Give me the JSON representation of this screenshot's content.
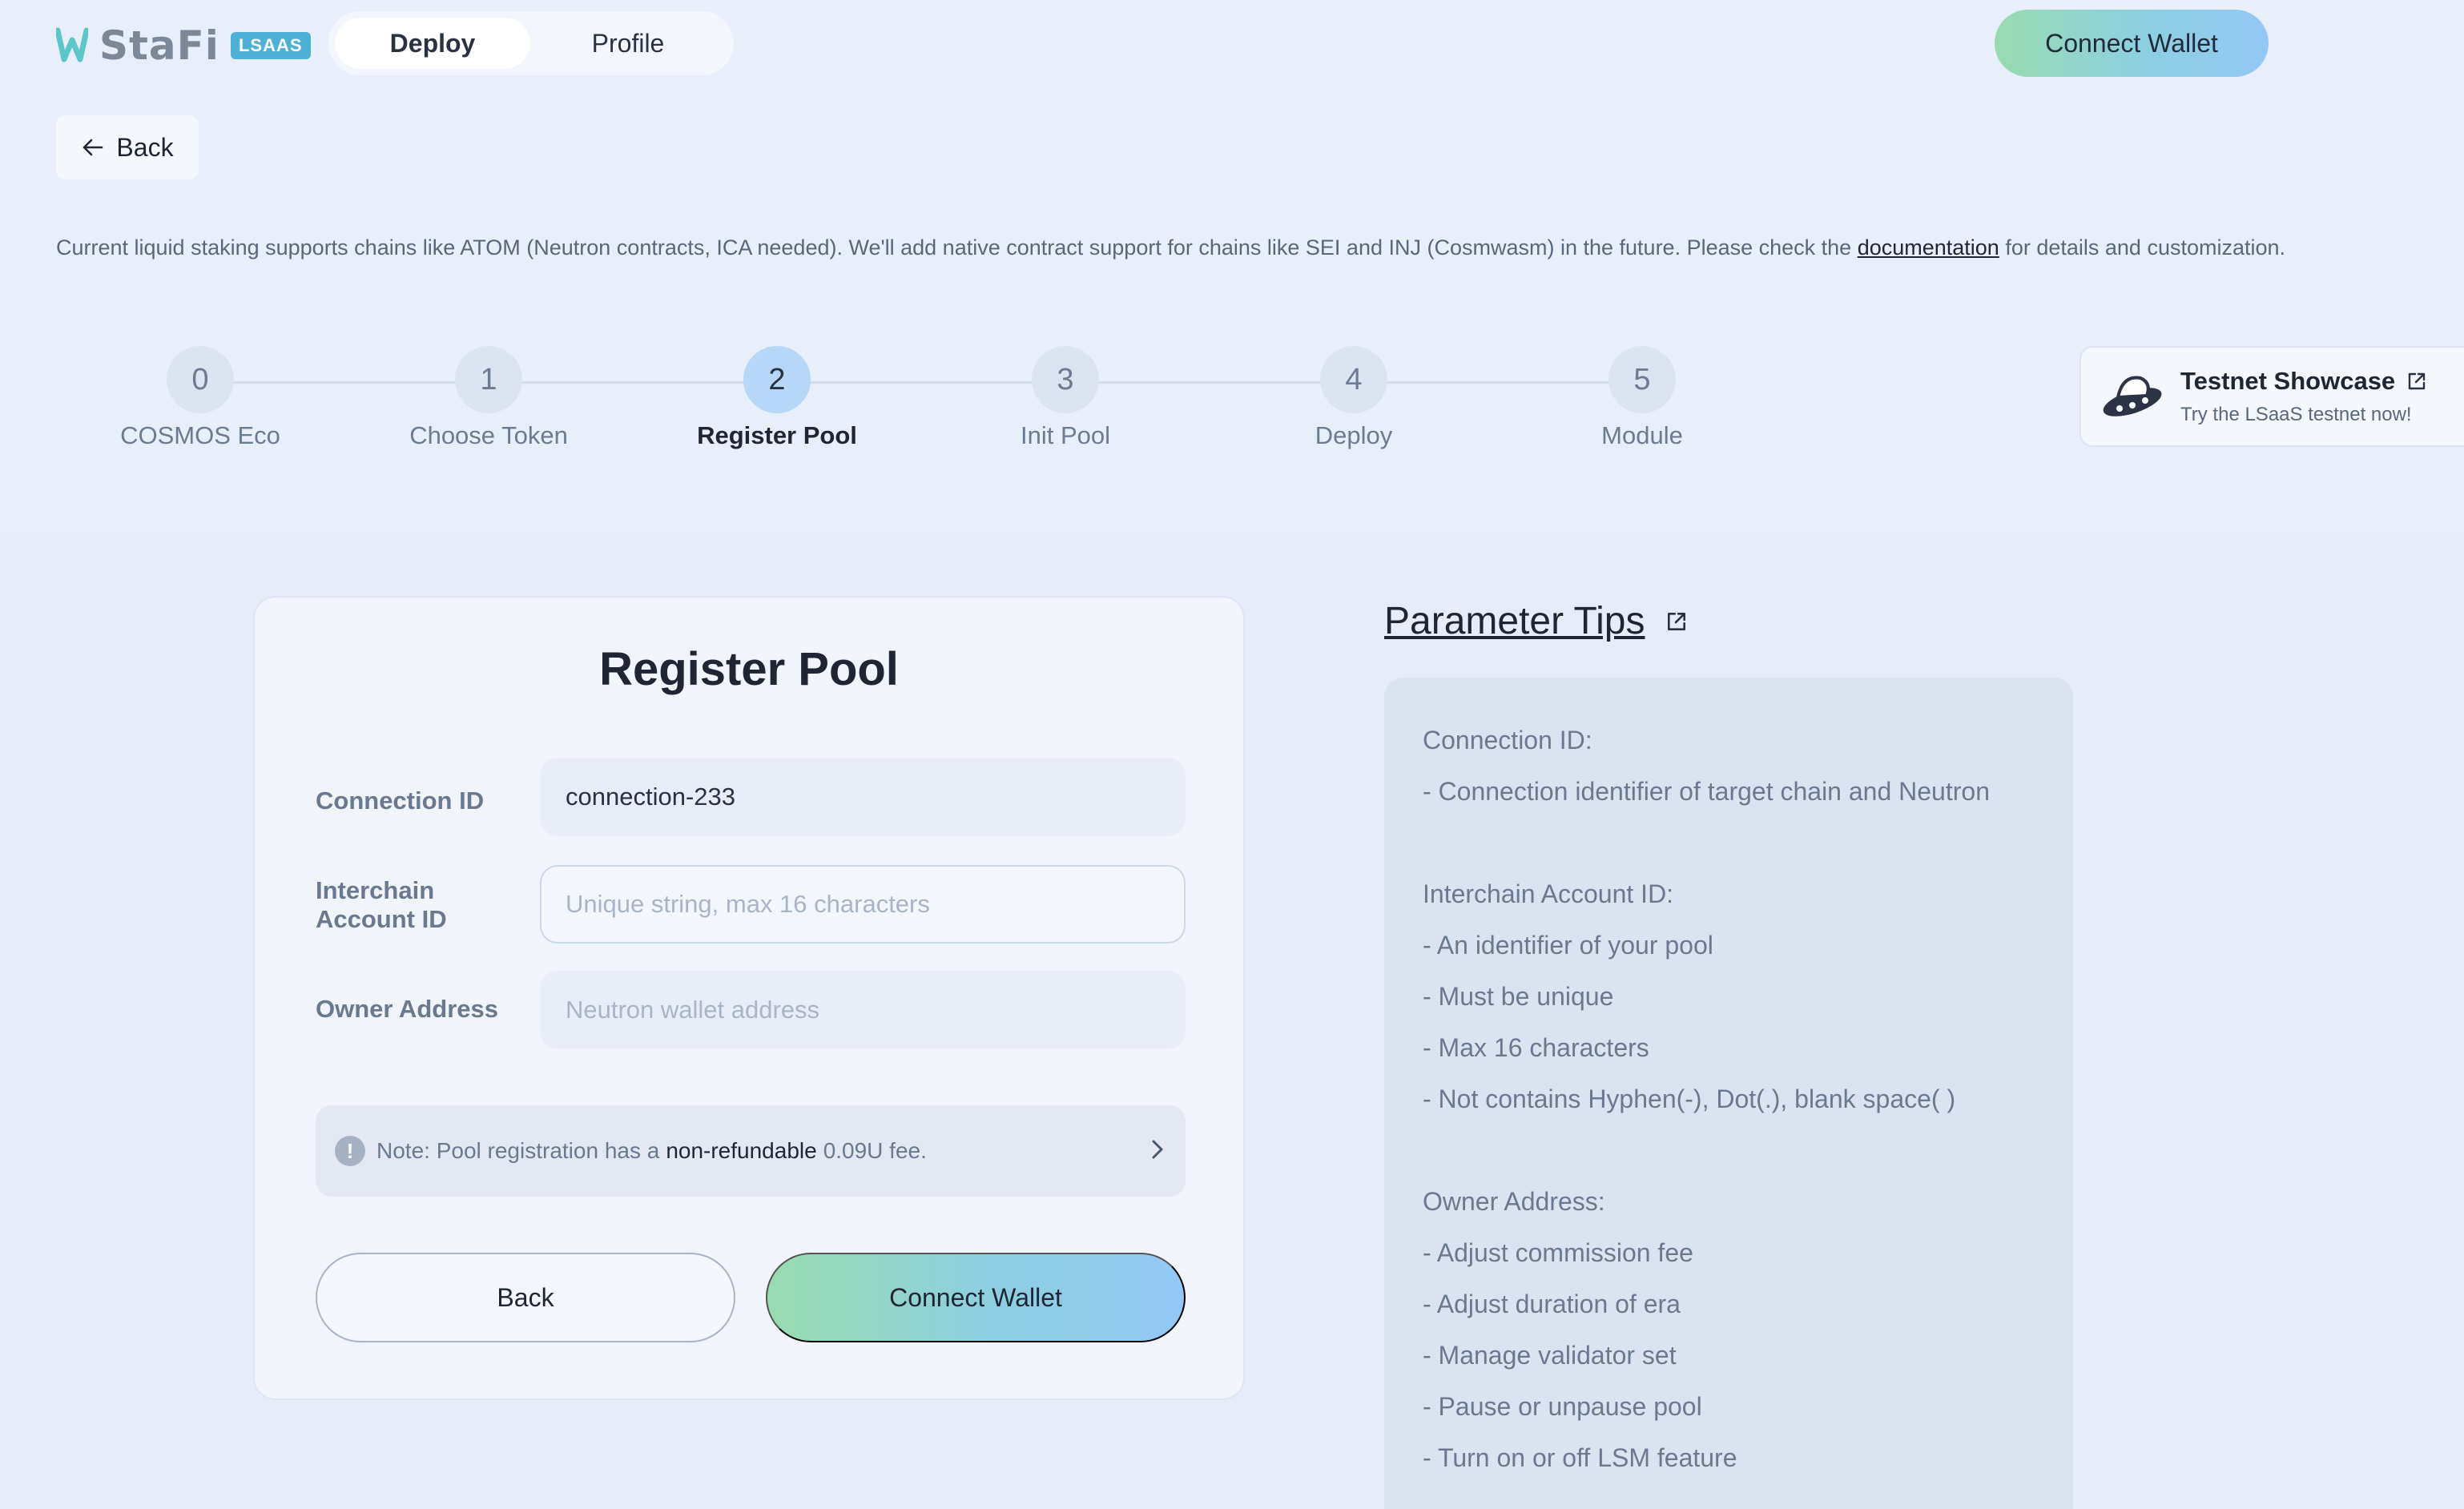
{
  "header": {
    "logo_text": "StaFi",
    "logo_badge": "LSAAS",
    "tabs": [
      {
        "label": "Deploy",
        "active": true
      },
      {
        "label": "Profile",
        "active": false
      }
    ],
    "connect_wallet_label": "Connect Wallet"
  },
  "back_label": "Back",
  "intro": {
    "text_before": "Current liquid staking supports chains like ATOM (Neutron contracts, ICA needed). We'll add native contract support for chains like SEI and INJ (Cosmwasm) in the future. Please check the ",
    "link": "documentation",
    "text_after": " for details and customization."
  },
  "stepper": {
    "current": 2,
    "steps": [
      {
        "number": "0",
        "label": "COSMOS Eco"
      },
      {
        "number": "1",
        "label": "Choose Token"
      },
      {
        "number": "2",
        "label": "Register Pool"
      },
      {
        "number": "3",
        "label": "Init Pool"
      },
      {
        "number": "4",
        "label": "Deploy"
      },
      {
        "number": "5",
        "label": "Module"
      }
    ]
  },
  "showcase": {
    "title": "Testnet Showcase",
    "subtitle": "Try the LSaaS testnet now!"
  },
  "form": {
    "title": "Register Pool",
    "connection_id": {
      "label": "Connection ID",
      "value": "connection-233"
    },
    "interchain_account_id": {
      "label_line1": "Interchain",
      "label_line2": "Account ID",
      "value": "",
      "placeholder": "Unique string, max 16 characters"
    },
    "owner_address": {
      "label": "Owner Address",
      "value": "",
      "placeholder": "Neutron wallet address"
    },
    "note": {
      "prefix": "Note: Pool registration has a",
      "emphasis": "non-refundable",
      "suffix": "0.09U fee."
    },
    "back_label": "Back",
    "connect_label": "Connect Wallet"
  },
  "tips": {
    "title": "Parameter Tips",
    "sections": [
      {
        "heading": "Connection ID:",
        "items": [
          "- Connection identifier of target chain and Neutron"
        ]
      },
      {
        "heading": "Interchain Account ID:",
        "items": [
          "- An identifier of your pool",
          "- Must be unique",
          "- Max 16 characters",
          "- Not contains Hyphen(-), Dot(.), blank space( )"
        ]
      },
      {
        "heading": "Owner Address:",
        "items": [
          "- Adjust commission fee",
          "- Adjust duration of era",
          "- Manage validator set",
          "- Pause or unpause pool",
          "- Turn on or off LSM feature"
        ]
      }
    ]
  },
  "colors": {
    "page_bg": "#e8eefa",
    "accent_gradient_start": "#98dbaf",
    "accent_gradient_end": "#93c7f5",
    "active_step": "#b7d7f8"
  }
}
